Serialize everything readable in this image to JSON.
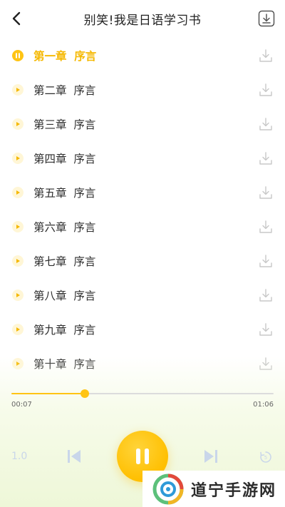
{
  "header": {
    "title": "别笑!我是日语学习书"
  },
  "chapters": [
    {
      "label": "第一章  序言",
      "state": "playing"
    },
    {
      "label": "第二章  序言",
      "state": "idle"
    },
    {
      "label": "第三章  序言",
      "state": "idle"
    },
    {
      "label": "第四章  序言",
      "state": "idle"
    },
    {
      "label": "第五章  序言",
      "state": "idle"
    },
    {
      "label": "第六章  序言",
      "state": "idle"
    },
    {
      "label": "第七章  序言",
      "state": "idle"
    },
    {
      "label": "第八章  序言",
      "state": "idle"
    },
    {
      "label": "第九章  序言",
      "state": "idle"
    },
    {
      "label": "第十章  序言",
      "state": "idle"
    }
  ],
  "player": {
    "current_time": "00:07",
    "total_time": "01:06",
    "progress": 0.28,
    "speed": "1.0"
  },
  "watermark": {
    "text": "道宁手游网"
  },
  "colors": {
    "accent": "#ffc414",
    "icon_gray": "#c8c8c8"
  },
  "icons": {
    "back": "chevron-left-icon",
    "download_all": "download-box-icon",
    "row_download": "download-icon",
    "playing": "pause-icon",
    "idle": "play-icon",
    "prev": "skip-previous-icon",
    "next": "skip-next-icon",
    "loop": "replay-icon"
  }
}
